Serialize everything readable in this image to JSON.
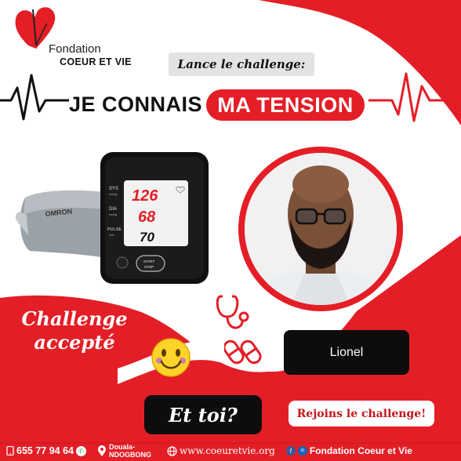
{
  "brand": {
    "line1": "Fondation",
    "line2": "COEUR  ET VIE",
    "red": "#e41e26",
    "dark": "#0d0d0d"
  },
  "tagline": "Lance le challenge:",
  "headline": {
    "left": "JE CONNAIS",
    "right": "MA TENSION"
  },
  "monitor": {
    "brand": "OMRON",
    "labels": {
      "sys": "SYS",
      "sys_unit": "mmHg",
      "dia": "DIA",
      "dia_unit": "mmHg",
      "pulse": "PULSE",
      "pulse_unit": "/min",
      "start": "START",
      "stop": "STOP"
    },
    "readings": {
      "sys": "126",
      "dia": "68",
      "pulse": "70"
    }
  },
  "person": {
    "name": "Lionel"
  },
  "accepted": {
    "line1": "Challenge",
    "line2": "accepté"
  },
  "et_toi": "Et toi?",
  "cta": "Rejoins le challenge!",
  "footer": {
    "phone": "655 77 94 64",
    "address_line1": "Douala-",
    "address_line2": "NDOGBONG",
    "website": "www.coeuretvie.org",
    "social": "Fondation Coeur et Vie"
  },
  "icons": [
    "heart-logo-icon",
    "heartbeat-line-icon",
    "stethoscope-icon",
    "pill-capsule-icon",
    "smiley-emoji-icon",
    "phone-icon",
    "whatsapp-icon",
    "location-pin-icon",
    "globe-icon",
    "facebook-icon",
    "linkedin-icon"
  ]
}
